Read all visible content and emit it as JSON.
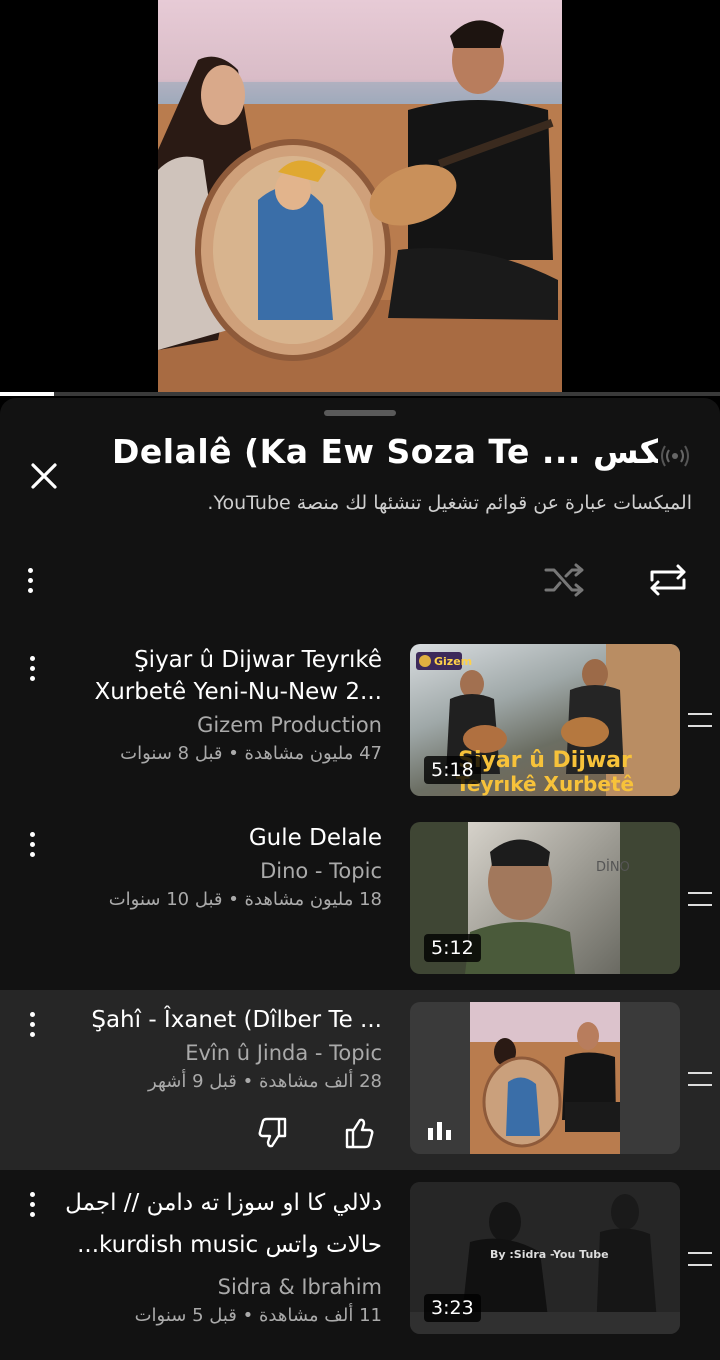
{
  "player": {
    "progress": 0.075
  },
  "panel": {
    "title": "Delalê (Ka Ew Soza Te ... ميكس",
    "subtitle": "الميكسات عبارة عن قوائم تشغيل تنشئها لك منصة YouTube."
  },
  "icons": {
    "close": "close-icon",
    "live": "broadcast-icon",
    "shuffle": "shuffle-icon",
    "repeat": "repeat-icon",
    "like": "thumbs-up-icon",
    "dislike": "thumbs-down-icon",
    "playing": "equalizer-icon",
    "drag": "drag-handle-icon"
  },
  "items": [
    {
      "title_line1": "Şiyar û Dijwar Teyrıkê",
      "title_line2": "Xurbetê  Yeni-Nu-New 2...",
      "channel": "Gizem Production",
      "meta": "47 مليون مشاهدة • قبل 8 سنوات",
      "duration": "5:18",
      "thumb_caption1": "Şiyar û Dijwar",
      "thumb_caption2": "Teyrıkê Xurbetê",
      "thumb_logo": "Gizem"
    },
    {
      "title_line1": "Gule Delale",
      "channel": "Dino - Topic",
      "meta": "18 مليون مشاهدة • قبل 10 سنوات",
      "duration": "5:12",
      "thumb_label": "DİNO"
    },
    {
      "title_line1": "Şahî - Îxanet (Dîlber Te ...",
      "channel": "Evîn û Jinda - Topic",
      "meta": "28 ألف مشاهدة • قبل 9 أشهر"
    },
    {
      "title_line1": "دلالي كا او سوزا ته دامن // اجمل",
      "title_line2": "حالات واتس kurdish music...",
      "channel": "Sidra & Ibrahim",
      "meta": "11 ألف مشاهدة • قبل 5 سنوات",
      "duration": "3:23",
      "thumb_watermark": "By :Sidra -You Tube"
    }
  ]
}
